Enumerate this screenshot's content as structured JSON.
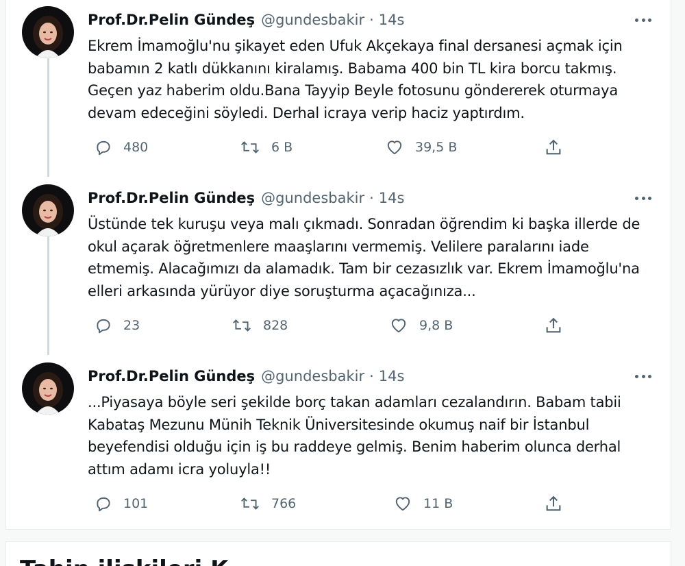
{
  "colors": {
    "text_primary": "#0f1419",
    "text_secondary": "#536471",
    "thread_line": "#cfd9de",
    "card_bg": "#ffffff",
    "page_bg": "#f7f9f9"
  },
  "tweets": [
    {
      "display_name": "Prof.Dr.Pelin Gündeş",
      "handle": "@gundesbakir",
      "separator": "·",
      "time": "14s",
      "text": "Ekrem İmamoğlu'nu şikayet eden Ufuk Akçekaya final dersanesi açmak için babamın 2 katlı dükkanını kiralamış. Babama 400 bin TL kira borcu takmış. Geçen yaz haberim oldu.Bana Tayyip Beyle fotosunu göndererek oturmaya devam edeceğini söyledi. Derhal icraya verip haciz yaptırdım.",
      "replies": "480",
      "retweets": "6 B",
      "likes": "39,5 B"
    },
    {
      "display_name": "Prof.Dr.Pelin Gündeş",
      "handle": "@gundesbakir",
      "separator": "·",
      "time": "14s",
      "text": "Üstünde tek kuruşu veya malı çıkmadı. Sonradan öğrendim ki başka illerde de okul açarak öğretmenlere maaşlarını vermemiş. Velilere paralarını iade etmemiş. Alacağımızı da alamadık. Tam bir cezasızlık var. Ekrem İmamoğlu'na elleri arkasında yürüyor diye soruşturma açacağınıza...",
      "replies": "23",
      "retweets": "828",
      "likes": "9,8 B"
    },
    {
      "display_name": "Prof.Dr.Pelin Gündeş",
      "handle": "@gundesbakir",
      "separator": "·",
      "time": "14s",
      "text": "...Piyasaya böyle seri şekilde borç takan adamları cezalandırın. Babam tabii Kabataş Mezunu Münih Teknik Üniversitesinde okumuş naif bir İstanbul beyefendisi olduğu için iş bu raddeye gelmiş. Benim haberim olunca derhal attım adamı icra yoluyla!!",
      "replies": "101",
      "retweets": "766",
      "likes": "11 B"
    }
  ],
  "icons": {
    "reply": "reply-icon",
    "retweet": "retweet-icon",
    "like": "heart-icon",
    "share": "share-icon",
    "more": "more-icon"
  },
  "bottom_section": {
    "heading": "Tahin ilişkileri K..."
  }
}
